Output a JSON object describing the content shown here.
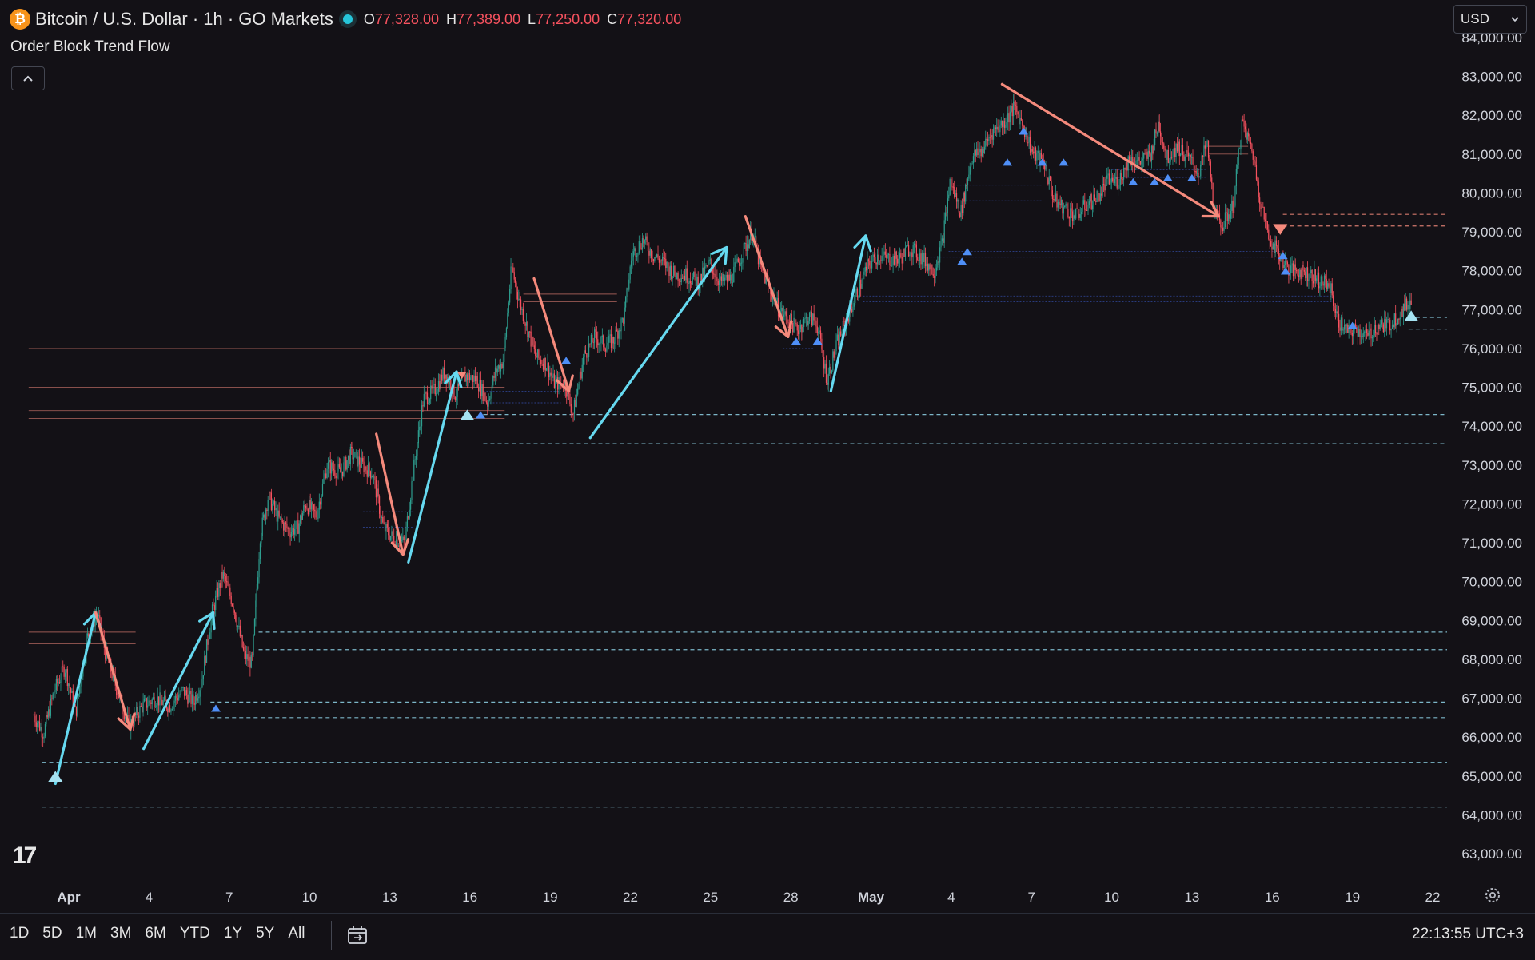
{
  "header": {
    "coin_glyph": "₿",
    "symbol_title": "Bitcoin / U.S. Dollar · 1h · GO Markets",
    "open_label": "O",
    "open": "77,328.00",
    "high_label": "H",
    "high": "77,389.00",
    "low_label": "L",
    "low": "77,250.00",
    "close_label": "C",
    "close": "77,320.00"
  },
  "indicator": {
    "name": "Order Block Trend Flow",
    "collapse_icon": "chevron-up-icon"
  },
  "currency_select": {
    "value": "USD",
    "icon": "chevron-down-icon"
  },
  "logo": "17",
  "bottom": {
    "ranges": [
      "1D",
      "5D",
      "1M",
      "3M",
      "6M",
      "YTD",
      "1Y",
      "5Y",
      "All"
    ],
    "clock": "22:13:55 UTC+3"
  },
  "colors": {
    "up": "#2e9e8f",
    "down": "#f7525f",
    "bull_arrow": "#66d9f0",
    "bear_arrow": "#f58a7c",
    "background": "#131116"
  },
  "chart_data": {
    "type": "candlestick",
    "title": "",
    "ylim": [
      62500,
      84200
    ],
    "y_ticks": [
      "63,000.00",
      "64,000.00",
      "65,000.00",
      "66,000.00",
      "67,000.00",
      "68,000.00",
      "69,000.00",
      "70,000.00",
      "71,000.00",
      "72,000.00",
      "73,000.00",
      "74,000.00",
      "75,000.00",
      "76,000.00",
      "77,000.00",
      "78,000.00",
      "79,000.00",
      "80,000.00",
      "81,000.00",
      "82,000.00",
      "83,000.00",
      "84,000.00"
    ],
    "x_ticks": [
      {
        "label": "Apr",
        "day": 1
      },
      {
        "label": "4",
        "day": 4
      },
      {
        "label": "7",
        "day": 7
      },
      {
        "label": "10",
        "day": 10
      },
      {
        "label": "13",
        "day": 13
      },
      {
        "label": "16",
        "day": 16
      },
      {
        "label": "19",
        "day": 19
      },
      {
        "label": "22",
        "day": 22
      },
      {
        "label": "25",
        "day": 25
      },
      {
        "label": "28",
        "day": 28
      },
      {
        "label": "May",
        "day": 31
      },
      {
        "label": "4",
        "day": 34
      },
      {
        "label": "7",
        "day": 37
      },
      {
        "label": "10",
        "day": 40
      },
      {
        "label": "13",
        "day": 43
      },
      {
        "label": "16",
        "day": 46
      },
      {
        "label": "19",
        "day": 49
      },
      {
        "label": "22",
        "day": 52
      }
    ],
    "price_path": [
      [
        -0.3,
        66600
      ],
      [
        0.1,
        66100
      ],
      [
        0.5,
        67200
      ],
      [
        0.9,
        67800
      ],
      [
        1.3,
        66600
      ],
      [
        1.7,
        68500
      ],
      [
        2.1,
        69200
      ],
      [
        2.4,
        68200
      ],
      [
        2.9,
        67100
      ],
      [
        3.3,
        66300
      ],
      [
        3.8,
        66800
      ],
      [
        4.3,
        67000
      ],
      [
        4.8,
        66800
      ],
      [
        5.3,
        67200
      ],
      [
        5.7,
        66900
      ],
      [
        6.0,
        67400
      ],
      [
        6.4,
        69200
      ],
      [
        6.8,
        70200
      ],
      [
        7.2,
        69400
      ],
      [
        7.6,
        68100
      ],
      [
        7.9,
        67900
      ],
      [
        8.2,
        71200
      ],
      [
        8.5,
        72200
      ],
      [
        8.9,
        71600
      ],
      [
        9.3,
        71300
      ],
      [
        9.6,
        71400
      ],
      [
        9.9,
        72000
      ],
      [
        10.3,
        71700
      ],
      [
        10.7,
        73000
      ],
      [
        11.2,
        72800
      ],
      [
        11.6,
        73300
      ],
      [
        12.0,
        73000
      ],
      [
        12.4,
        72800
      ],
      [
        12.8,
        71400
      ],
      [
        13.2,
        71100
      ],
      [
        13.6,
        71000
      ],
      [
        13.9,
        72700
      ],
      [
        14.3,
        74700
      ],
      [
        14.7,
        74900
      ],
      [
        15.1,
        75400
      ],
      [
        15.5,
        74800
      ],
      [
        15.9,
        75300
      ],
      [
        16.3,
        75200
      ],
      [
        16.7,
        74600
      ],
      [
        17.0,
        75400
      ],
      [
        17.3,
        75700
      ],
      [
        17.6,
        78100
      ],
      [
        17.9,
        77200
      ],
      [
        18.2,
        76500
      ],
      [
        18.5,
        75800
      ],
      [
        18.9,
        75600
      ],
      [
        19.2,
        75100
      ],
      [
        19.6,
        75100
      ],
      [
        19.9,
        74300
      ],
      [
        20.3,
        75800
      ],
      [
        20.7,
        76300
      ],
      [
        21.1,
        76100
      ],
      [
        21.4,
        76200
      ],
      [
        21.8,
        76800
      ],
      [
        22.1,
        78400
      ],
      [
        22.5,
        78800
      ],
      [
        22.9,
        78400
      ],
      [
        23.3,
        78200
      ],
      [
        23.7,
        77900
      ],
      [
        24.1,
        77900
      ],
      [
        24.6,
        77700
      ],
      [
        25.0,
        78200
      ],
      [
        25.4,
        77700
      ],
      [
        25.8,
        77800
      ],
      [
        26.2,
        78400
      ],
      [
        26.6,
        79000
      ],
      [
        26.9,
        78100
      ],
      [
        27.2,
        77600
      ],
      [
        27.6,
        77000
      ],
      [
        28.0,
        76700
      ],
      [
        28.3,
        76500
      ],
      [
        28.7,
        76800
      ],
      [
        29.0,
        76700
      ],
      [
        29.4,
        75200
      ],
      [
        29.8,
        76200
      ],
      [
        30.1,
        76700
      ],
      [
        30.5,
        77400
      ],
      [
        30.9,
        78100
      ],
      [
        31.3,
        78400
      ],
      [
        31.7,
        78300
      ],
      [
        32.1,
        78300
      ],
      [
        32.5,
        78600
      ],
      [
        33.0,
        78300
      ],
      [
        33.4,
        78000
      ],
      [
        33.7,
        78700
      ],
      [
        34.0,
        80300
      ],
      [
        34.4,
        79500
      ],
      [
        34.8,
        80900
      ],
      [
        35.2,
        81100
      ],
      [
        35.6,
        81600
      ],
      [
        36.0,
        81800
      ],
      [
        36.4,
        82200
      ],
      [
        36.7,
        81800
      ],
      [
        37.1,
        81000
      ],
      [
        37.5,
        80800
      ],
      [
        37.9,
        79800
      ],
      [
        38.3,
        79600
      ],
      [
        38.7,
        79400
      ],
      [
        39.1,
        79700
      ],
      [
        39.5,
        79900
      ],
      [
        39.9,
        80300
      ],
      [
        40.3,
        80300
      ],
      [
        40.7,
        80900
      ],
      [
        41.1,
        80800
      ],
      [
        41.5,
        81000
      ],
      [
        41.8,
        81800
      ],
      [
        42.1,
        80900
      ],
      [
        42.5,
        81200
      ],
      [
        42.9,
        80900
      ],
      [
        43.3,
        80500
      ],
      [
        43.6,
        81300
      ],
      [
        43.9,
        79400
      ],
      [
        44.2,
        79200
      ],
      [
        44.6,
        79700
      ],
      [
        44.9,
        81800
      ],
      [
        45.3,
        81100
      ],
      [
        45.6,
        79800
      ],
      [
        45.9,
        78900
      ],
      [
        46.3,
        78400
      ],
      [
        46.7,
        78000
      ],
      [
        47.1,
        78000
      ],
      [
        47.5,
        77900
      ],
      [
        47.9,
        77700
      ],
      [
        48.2,
        77600
      ],
      [
        48.5,
        76700
      ],
      [
        48.9,
        76400
      ],
      [
        49.2,
        76500
      ],
      [
        49.6,
        76300
      ],
      [
        50.0,
        76600
      ],
      [
        50.4,
        76600
      ],
      [
        50.8,
        76900
      ],
      [
        51.2,
        77200
      ]
    ],
    "bull_arrows": [
      [
        [
          0.5,
          64800
        ],
        [
          2.0,
          69200
        ]
      ],
      [
        [
          3.8,
          65700
        ],
        [
          6.4,
          69200
        ]
      ],
      [
        [
          13.7,
          70500
        ],
        [
          15.5,
          75400
        ]
      ],
      [
        [
          20.5,
          73700
        ],
        [
          25.6,
          78600
        ]
      ],
      [
        [
          29.5,
          74900
        ],
        [
          30.8,
          78900
        ]
      ]
    ],
    "bear_arrows": [
      [
        [
          2.0,
          69200
        ],
        [
          3.3,
          66200
        ]
      ],
      [
        [
          12.5,
          73800
        ],
        [
          13.5,
          70700
        ]
      ],
      [
        [
          18.4,
          77800
        ],
        [
          19.7,
          74900
        ]
      ],
      [
        [
          26.3,
          79400
        ],
        [
          27.9,
          76300
        ]
      ],
      [
        [
          35.9,
          82800
        ],
        [
          44.0,
          79400
        ]
      ]
    ],
    "dashed_levels": [
      {
        "y": 64200,
        "color": "bull",
        "x0": 0
      },
      {
        "y": 65350,
        "color": "bull",
        "x0": 0
      },
      {
        "y": 66500,
        "color": "bull",
        "x0": 6.3
      },
      {
        "y": 66900,
        "color": "bull",
        "x0": 6.3
      },
      {
        "y": 68250,
        "color": "bull",
        "x0": 8.1
      },
      {
        "y": 68700,
        "color": "bull",
        "x0": 8.1
      },
      {
        "y": 73550,
        "color": "bull",
        "x0": 16.5
      },
      {
        "y": 74300,
        "color": "bull",
        "x0": 16.5
      },
      {
        "y": 76500,
        "color": "bull",
        "x0": 51.1
      },
      {
        "y": 76800,
        "color": "bull",
        "x0": 51.1
      },
      {
        "y": 79150,
        "color": "bear",
        "x0": 46.4
      },
      {
        "y": 79450,
        "color": "bear",
        "x0": 46.4
      }
    ],
    "thin_levels": [
      {
        "y": 75000,
        "color": "bear",
        "x0": -0.5,
        "x1": 17.3
      },
      {
        "y": 74400,
        "color": "bear",
        "x0": -0.5,
        "x1": 17.3
      },
      {
        "y": 74200,
        "color": "bear",
        "x0": -0.5,
        "x1": 17.3
      },
      {
        "y": 76000,
        "color": "bear",
        "x0": -0.5,
        "x1": 17.3
      },
      {
        "y": 77200,
        "color": "bear",
        "x0": 18.0,
        "x1": 21.5
      },
      {
        "y": 77400,
        "color": "bear",
        "x0": 18.0,
        "x1": 21.5
      },
      {
        "y": 68700,
        "color": "bear",
        "x0": -0.5,
        "x1": 3.5
      },
      {
        "y": 68400,
        "color": "bear",
        "x0": -0.5,
        "x1": 3.5
      },
      {
        "y": 81200,
        "color": "bear",
        "x0": 43.6,
        "x1": 45.1
      },
      {
        "y": 81000,
        "color": "bear",
        "x0": 43.6,
        "x1": 45.1
      },
      {
        "y": 77200,
        "color": "blue",
        "x0": 30.7,
        "x1": 48.3
      },
      {
        "y": 77350,
        "color": "blue",
        "x0": 30.7,
        "x1": 48.3
      },
      {
        "y": 78150,
        "color": "blue",
        "x0": 32.5,
        "x1": 46.4
      },
      {
        "y": 78350,
        "color": "blue",
        "x0": 32.5,
        "x1": 46.4
      },
      {
        "y": 78500,
        "color": "blue",
        "x0": 33.9,
        "x1": 46.3
      },
      {
        "y": 79800,
        "color": "blue",
        "x0": 34.2,
        "x1": 37.4
      },
      {
        "y": 80200,
        "color": "blue",
        "x0": 34.2,
        "x1": 37.4
      },
      {
        "y": 80400,
        "color": "blue",
        "x0": 40.0,
        "x1": 43.5
      },
      {
        "y": 80600,
        "color": "blue",
        "x0": 40.0,
        "x1": 43.5
      },
      {
        "y": 71800,
        "color": "blue",
        "x0": 12.0,
        "x1": 13.9
      },
      {
        "y": 71400,
        "color": "blue",
        "x0": 12.0,
        "x1": 13.9
      },
      {
        "y": 74600,
        "color": "blue",
        "x0": 16.5,
        "x1": 19.4
      },
      {
        "y": 74900,
        "color": "blue",
        "x0": 16.5,
        "x1": 19.4
      },
      {
        "y": 75600,
        "color": "blue",
        "x0": 16.5,
        "x1": 19.4
      },
      {
        "y": 76000,
        "color": "blue",
        "x0": 27.7,
        "x1": 28.9
      },
      {
        "y": 75600,
        "color": "blue",
        "x0": 27.7,
        "x1": 28.9
      }
    ],
    "markers_up": [
      [
        0.5,
        64850,
        "big"
      ],
      [
        6.5,
        66650,
        "small"
      ],
      [
        15.9,
        74150,
        "big"
      ],
      [
        16.4,
        74200,
        "small"
      ],
      [
        19.6,
        75600,
        "small"
      ],
      [
        28.2,
        76100,
        "small"
      ],
      [
        29.0,
        76100,
        "small"
      ],
      [
        34.6,
        78400,
        "small"
      ],
      [
        34.4,
        78150,
        "small"
      ],
      [
        36.1,
        80700,
        "small"
      ],
      [
        36.7,
        81500,
        "small"
      ],
      [
        37.4,
        80700,
        "small"
      ],
      [
        38.2,
        80700,
        "small"
      ],
      [
        40.8,
        80200,
        "small"
      ],
      [
        41.6,
        80200,
        "small"
      ],
      [
        42.1,
        80300,
        "small"
      ],
      [
        43.0,
        80300,
        "small"
      ],
      [
        46.4,
        78300,
        "small"
      ],
      [
        46.5,
        77900,
        "small"
      ],
      [
        49.0,
        76500,
        "small"
      ],
      [
        51.2,
        76700,
        "big"
      ]
    ],
    "markers_down": [
      [
        15.7,
        75400,
        "small"
      ],
      [
        46.3,
        79200,
        "big"
      ]
    ]
  }
}
